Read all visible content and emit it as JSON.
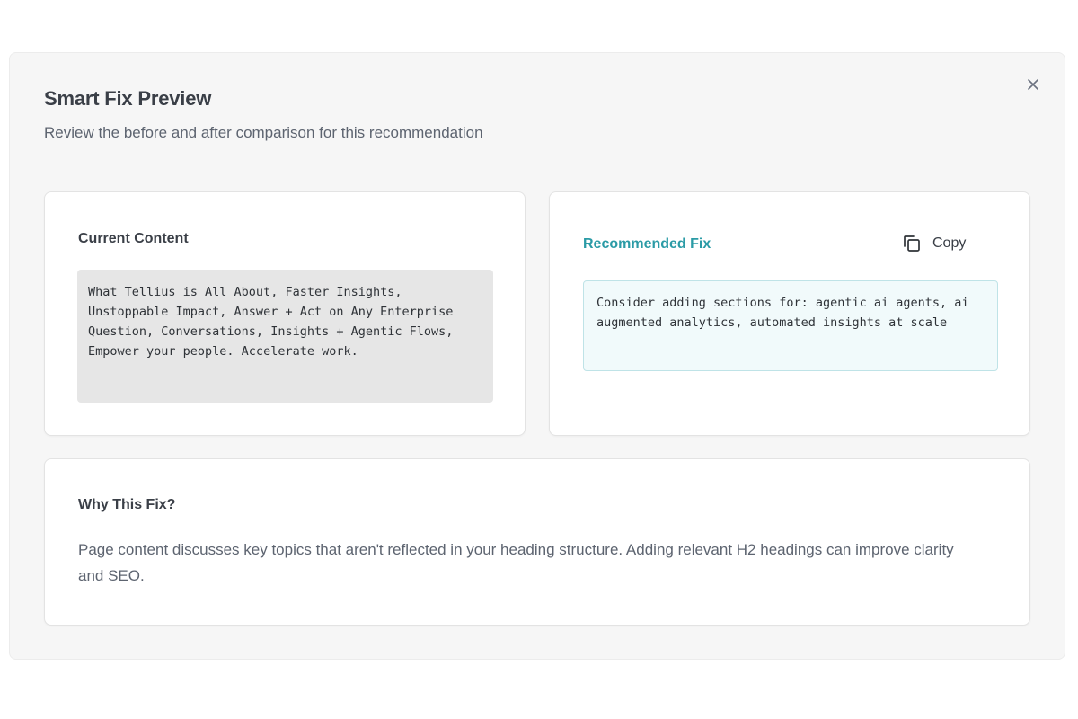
{
  "dialog": {
    "title": "Smart Fix Preview",
    "subtitle": "Review the before and after comparison for this recommendation",
    "close_icon": "close-icon"
  },
  "current": {
    "heading": "Current Content",
    "text": "What Tellius is All About, Faster Insights, Unstoppable Impact, Answer + Act on Any Enterprise Question, Conversations, Insights + Agentic Flows, Empower your people. Accelerate work."
  },
  "fix": {
    "heading": "Recommended Fix",
    "copy_label": "Copy",
    "copy_icon": "copy-icon",
    "text": "Consider adding sections for: agentic ai agents, ai augmented analytics, automated insights at scale"
  },
  "why": {
    "heading": "Why This Fix?",
    "text": "Page content discusses key topics that aren't reflected in your heading structure. Adding relevant H2 headings can improve clarity and SEO."
  },
  "colors": {
    "accent": "#2b9ba6",
    "modal_bg": "#f6f6f6",
    "code_current_bg": "#e6e6e6",
    "code_fix_bg": "#f1fafb"
  }
}
